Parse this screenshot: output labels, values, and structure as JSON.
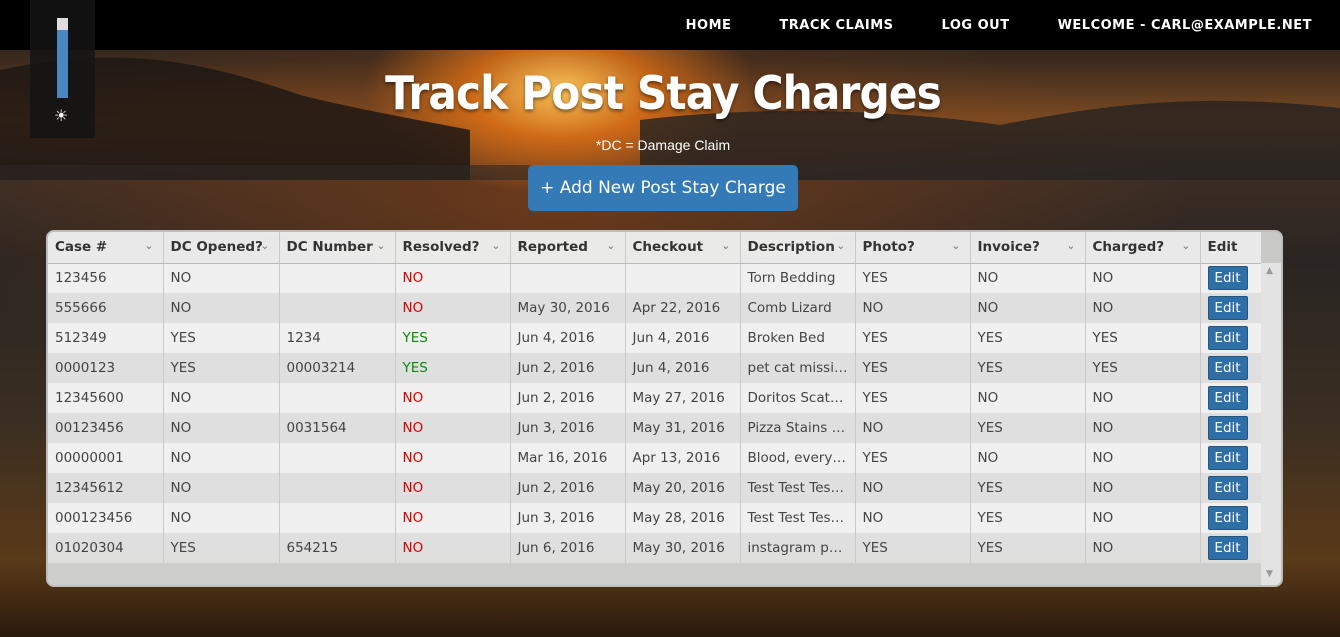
{
  "nav": {
    "home": "HOME",
    "track_claims": "TRACK CLAIMS",
    "log_out": "LOG OUT",
    "welcome": "WELCOME - CARL@EXAMPLE.NET"
  },
  "brightness": {
    "level": 0.85
  },
  "page": {
    "title": "Track Post Stay Charges",
    "subtitle": "*DC = Damage Claim",
    "add_button": "+ Add New Post Stay Charge"
  },
  "grid": {
    "columns": [
      "Case #",
      "DC Opened?",
      "DC Number",
      "Resolved?",
      "Reported",
      "Checkout",
      "Description",
      "Photo?",
      "Invoice?",
      "Charged?",
      "Edit"
    ],
    "edit_label": "Edit",
    "rows": [
      [
        "123456",
        "NO",
        "",
        "NO",
        "",
        "",
        "Torn Bedding",
        "YES",
        "NO",
        "NO"
      ],
      [
        "555666",
        "NO",
        "",
        "NO",
        "May 30, 2016",
        "Apr 22, 2016",
        "Comb Lizard",
        "NO",
        "NO",
        "NO"
      ],
      [
        "512349",
        "YES",
        "1234",
        "YES",
        "Jun 4, 2016",
        "Jun 4, 2016",
        "Broken Bed",
        "YES",
        "YES",
        "YES"
      ],
      [
        "0000123",
        "YES",
        "00003214",
        "YES",
        "Jun 2, 2016",
        "Jun 4, 2016",
        "pet cat missing",
        "YES",
        "YES",
        "YES"
      ],
      [
        "12345600",
        "NO",
        "",
        "NO",
        "Jun 2, 2016",
        "May 27, 2016",
        "Doritos Scatte...",
        "YES",
        "NO",
        "NO"
      ],
      [
        "00123456",
        "NO",
        "0031564",
        "NO",
        "Jun 3, 2016",
        "May 31, 2016",
        "Pizza Stains Ev...",
        "NO",
        "YES",
        "NO"
      ],
      [
        "00000001",
        "NO",
        "",
        "NO",
        "Mar 16, 2016",
        "Apr 13, 2016",
        "Blood, everyw...",
        "YES",
        "NO",
        "NO"
      ],
      [
        "12345612",
        "NO",
        "",
        "NO",
        "Jun 2, 2016",
        "May 20, 2016",
        "Test Test Test ...",
        "NO",
        "YES",
        "NO"
      ],
      [
        "000123456",
        "NO",
        "",
        "NO",
        "Jun 3, 2016",
        "May 28, 2016",
        "Test Test Test ...",
        "NO",
        "YES",
        "NO"
      ],
      [
        "01020304",
        "YES",
        "654215",
        "NO",
        "Jun 6, 2016",
        "May 30, 2016",
        "instagram party",
        "YES",
        "YES",
        "NO"
      ]
    ]
  },
  "colors": {
    "accent": "#337ab7",
    "no": "#dd0000",
    "yes": "#0a8a0a"
  }
}
